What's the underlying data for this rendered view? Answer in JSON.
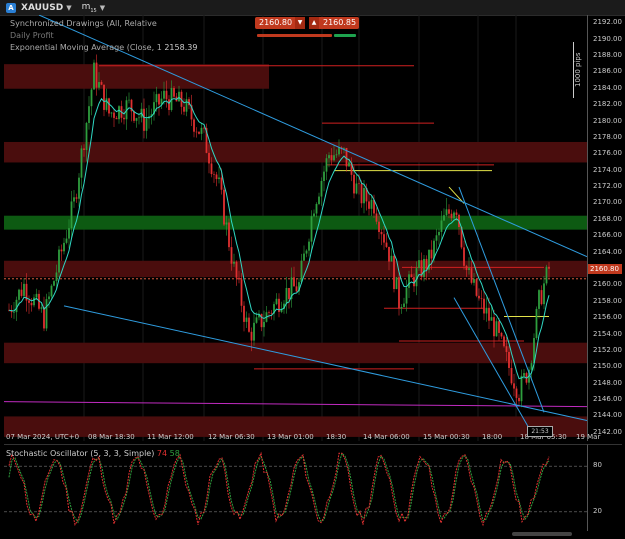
{
  "toolbar": {
    "symbol_badge": "A",
    "symbol": "XAUUSD",
    "symbol_caret": "▼",
    "timeframe_label": "m",
    "timeframe_sub": "15",
    "timeframe_caret": "▼"
  },
  "overlays": {
    "line1": "Synchronized Drawings (All, Relative",
    "line2": "Daily Profit",
    "ema_label": "Exponential Moving Average (Close, 1",
    "ema_value": "2158.39"
  },
  "trade_buttons": {
    "sell_price": "2160.80",
    "buy_price": "2160.85",
    "sell_arrow": "▼",
    "buy_arrow": "▲"
  },
  "pips_label": "1000 pips",
  "current_price": "2160.80",
  "date_marker": "21:53",
  "price_axis": [
    "2192.00",
    "2190.00",
    "2188.00",
    "2186.00",
    "2184.00",
    "2182.00",
    "2180.00",
    "2178.00",
    "2176.00",
    "2174.00",
    "2172.00",
    "2170.00",
    "2168.00",
    "2166.00",
    "2164.00",
    "2162.00",
    "2160.00",
    "2158.00",
    "2156.00",
    "2154.00",
    "2152.00",
    "2150.00",
    "2148.00",
    "2146.00",
    "2144.00",
    "2142.00"
  ],
  "time_axis": [
    "07 Mar 2024, UTC+0",
    "08 Mar 18:30",
    "11 Mar 12:00",
    "12 Mar 06:30",
    "13 Mar 01:00",
    "18:30",
    "14 Mar 06:00",
    "15 Mar 00:30",
    "18:00",
    "18 Mar 05:30",
    "19 Mar"
  ],
  "oscillator": {
    "name": "Stochastic Oscillator (5, 3, 3, Simple)",
    "k_value": "74",
    "d_value": "58",
    "axis": [
      "80",
      "20"
    ]
  },
  "colors": {
    "bull": "#2e9e3e",
    "bear": "#e03030",
    "ema": "#2fd8c4",
    "trend": "#2f9de0",
    "red_zone": "#4a0d0d",
    "green_zone": "#0d5a12",
    "yellow": "#e4e44a",
    "magenta": "#c02bc0"
  },
  "chart_data": {
    "type": "candlestick",
    "y_range": [
      2141,
      2193
    ],
    "price_labels": [
      "2192.00",
      "2142.00"
    ]
  }
}
